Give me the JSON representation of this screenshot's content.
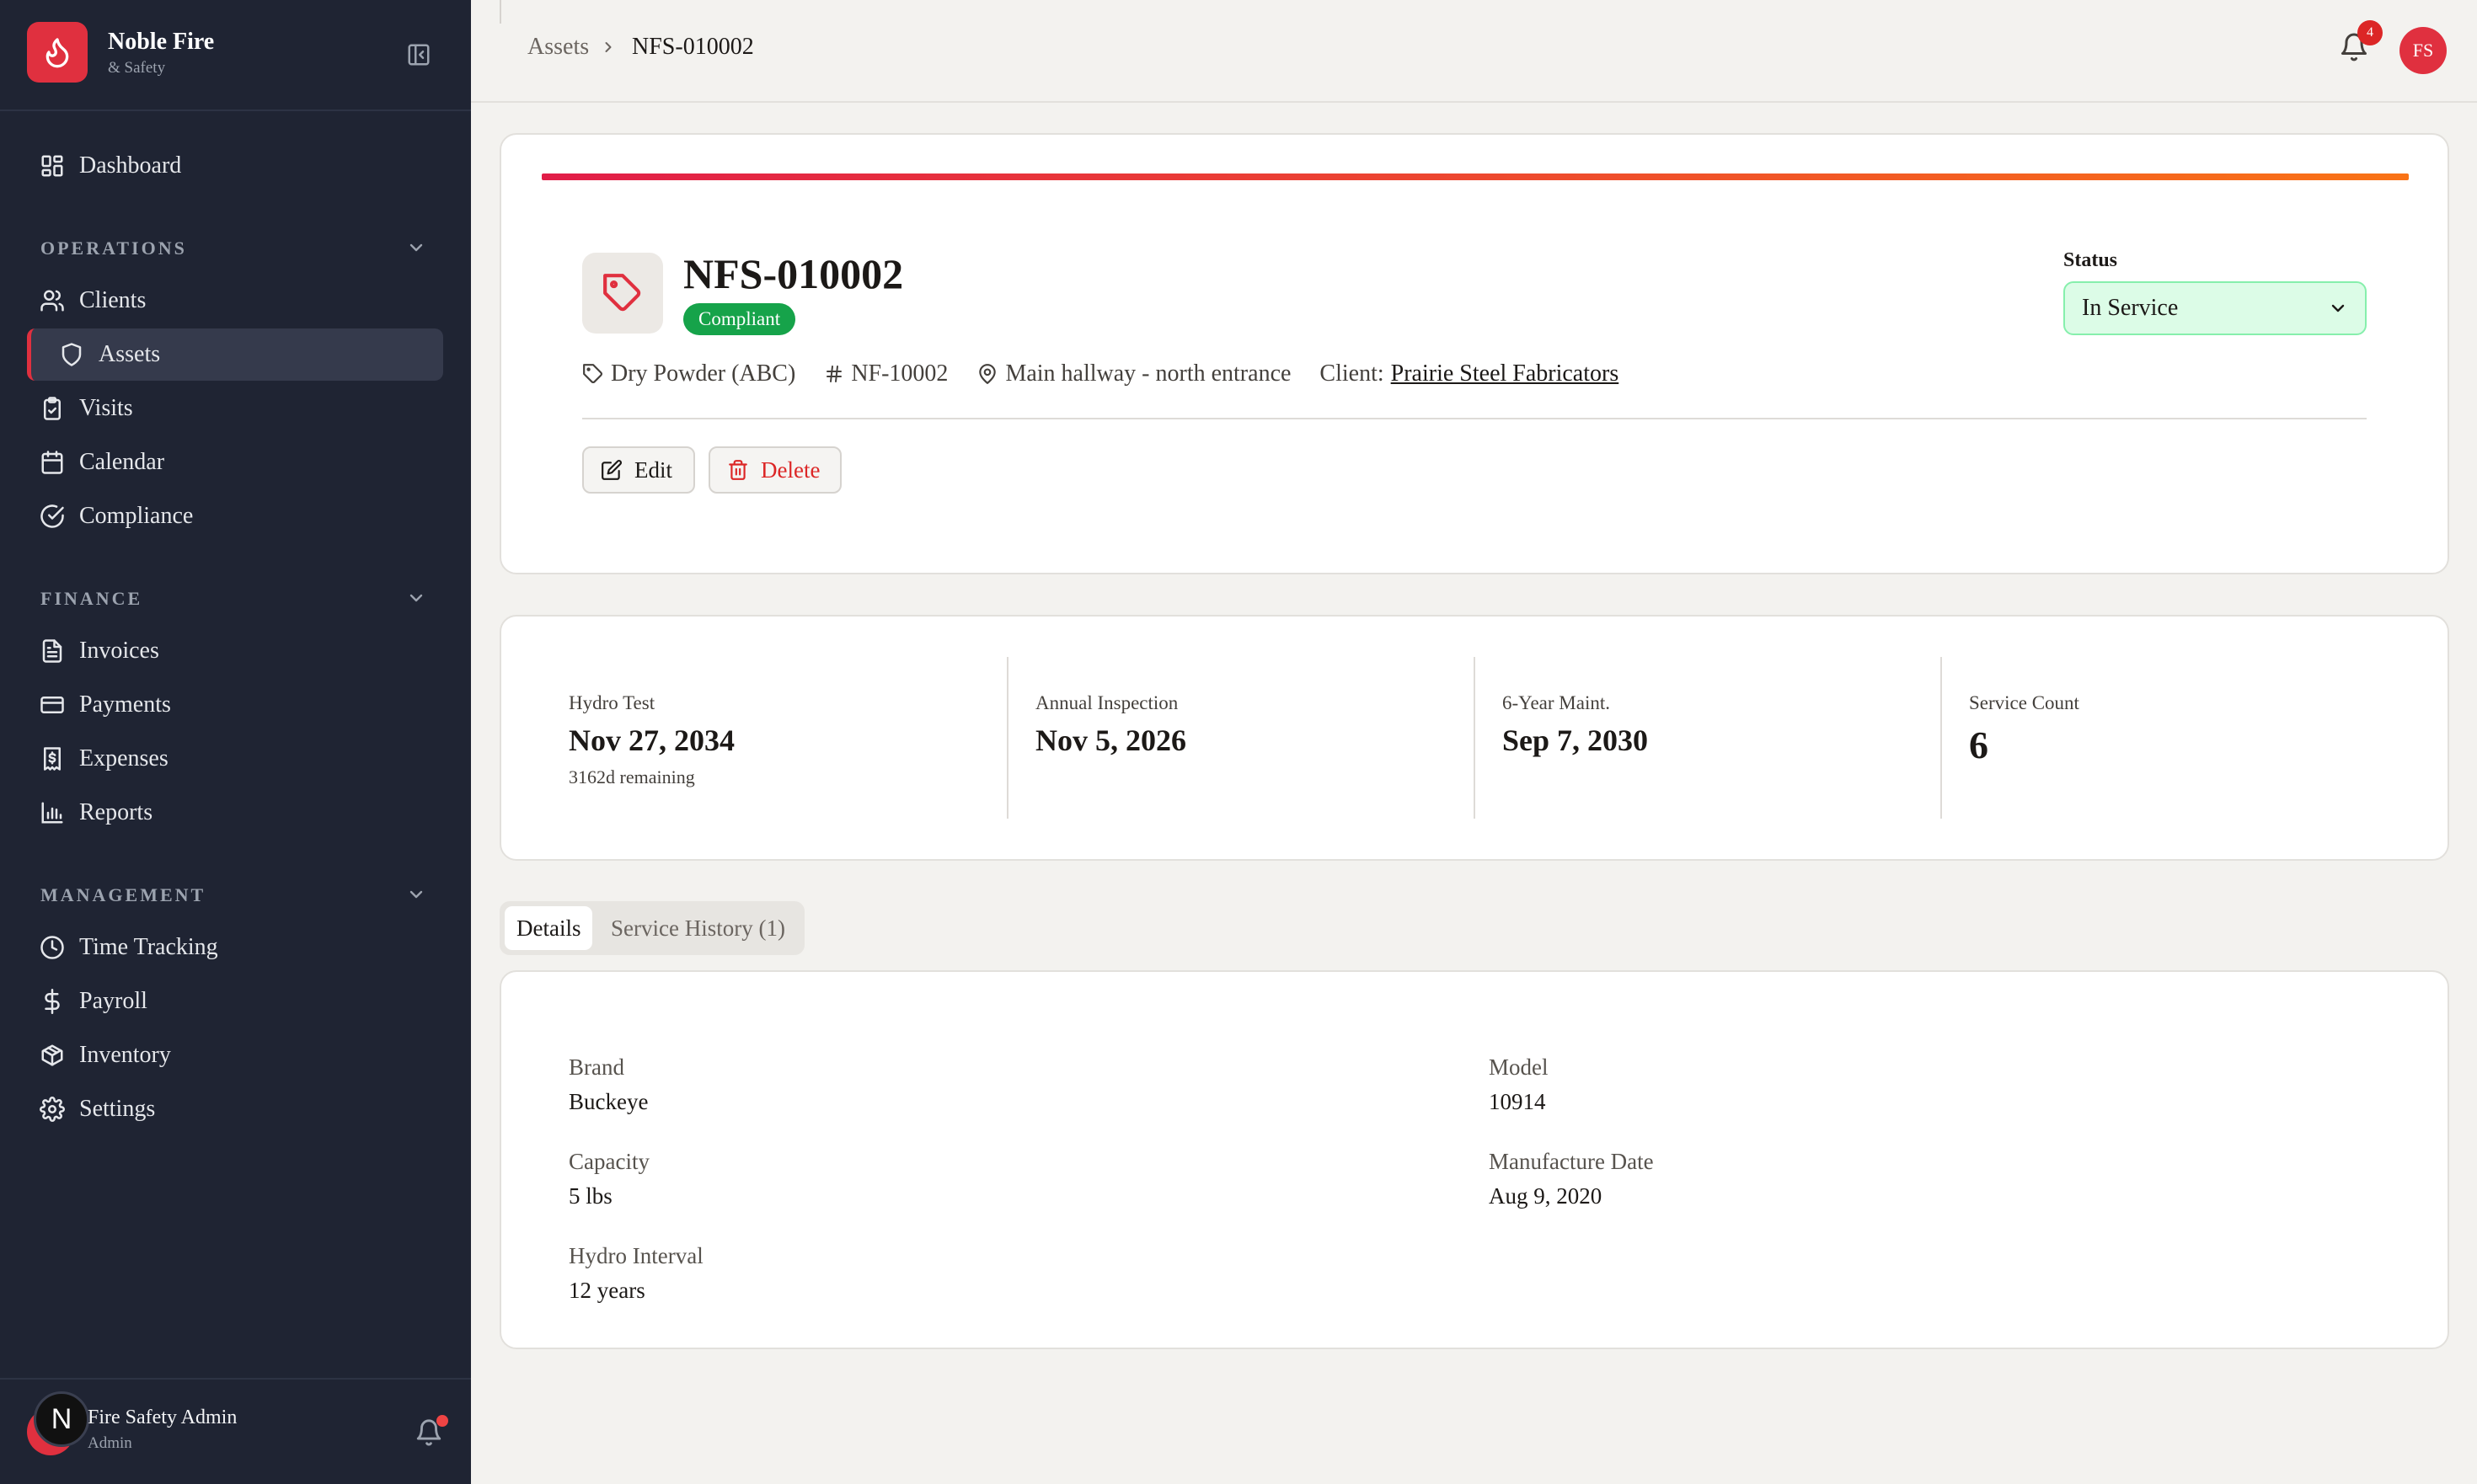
{
  "brand": {
    "name": "Noble Fire",
    "subtitle": "& Safety",
    "accent": "#e0303f"
  },
  "sidebar": {
    "dashboard": "Dashboard",
    "sections": {
      "operations": {
        "title": "OPERATIONS",
        "items": [
          "Clients",
          "Assets",
          "Visits",
          "Calendar",
          "Compliance"
        ]
      },
      "finance": {
        "title": "FINANCE",
        "items": [
          "Invoices",
          "Payments",
          "Expenses",
          "Reports"
        ]
      },
      "management": {
        "title": "MANAGEMENT",
        "items": [
          "Time Tracking",
          "Payroll",
          "Inventory",
          "Settings"
        ]
      }
    },
    "active_item": "Assets",
    "user": {
      "initial": "N",
      "name": "Fire Safety Admin",
      "role": "Admin"
    }
  },
  "topbar": {
    "breadcrumb": {
      "root": "Assets",
      "current": "NFS-010002"
    },
    "notifications_count": "4",
    "avatar_initials": "FS"
  },
  "asset": {
    "id": "NFS-010002",
    "compliance_badge": "Compliant",
    "type": "Dry Powder (ABC)",
    "serial": "NF-10002",
    "location": "Main hallway - north entrance",
    "client_label": "Client:",
    "client_name": "Prairie Steel Fabricators",
    "status_label": "Status",
    "status_value": "In Service",
    "actions": {
      "edit": "Edit",
      "delete": "Delete"
    }
  },
  "stats": [
    {
      "label": "Hydro Test",
      "value": "Nov 27, 2034",
      "sub": "3162d remaining"
    },
    {
      "label": "Annual Inspection",
      "value": "Nov 5, 2026",
      "sub": ""
    },
    {
      "label": "6-Year Maint.",
      "value": "Sep 7, 2030",
      "sub": ""
    },
    {
      "label": "Service Count",
      "value": "6",
      "sub": ""
    }
  ],
  "tabs": {
    "details": "Details",
    "history": "Service History (1)",
    "active": "Details"
  },
  "details": {
    "brand": {
      "label": "Brand",
      "value": "Buckeye"
    },
    "model": {
      "label": "Model",
      "value": "10914"
    },
    "capacity": {
      "label": "Capacity",
      "value": "5 lbs"
    },
    "manufacture_date": {
      "label": "Manufacture Date",
      "value": "Aug 9, 2020"
    },
    "hydro_interval": {
      "label": "Hydro Interval",
      "value": "12 years"
    }
  },
  "colors": {
    "sidebar_bg": "#1f2433",
    "status_green": "#16a34a",
    "danger": "#dc2626"
  }
}
